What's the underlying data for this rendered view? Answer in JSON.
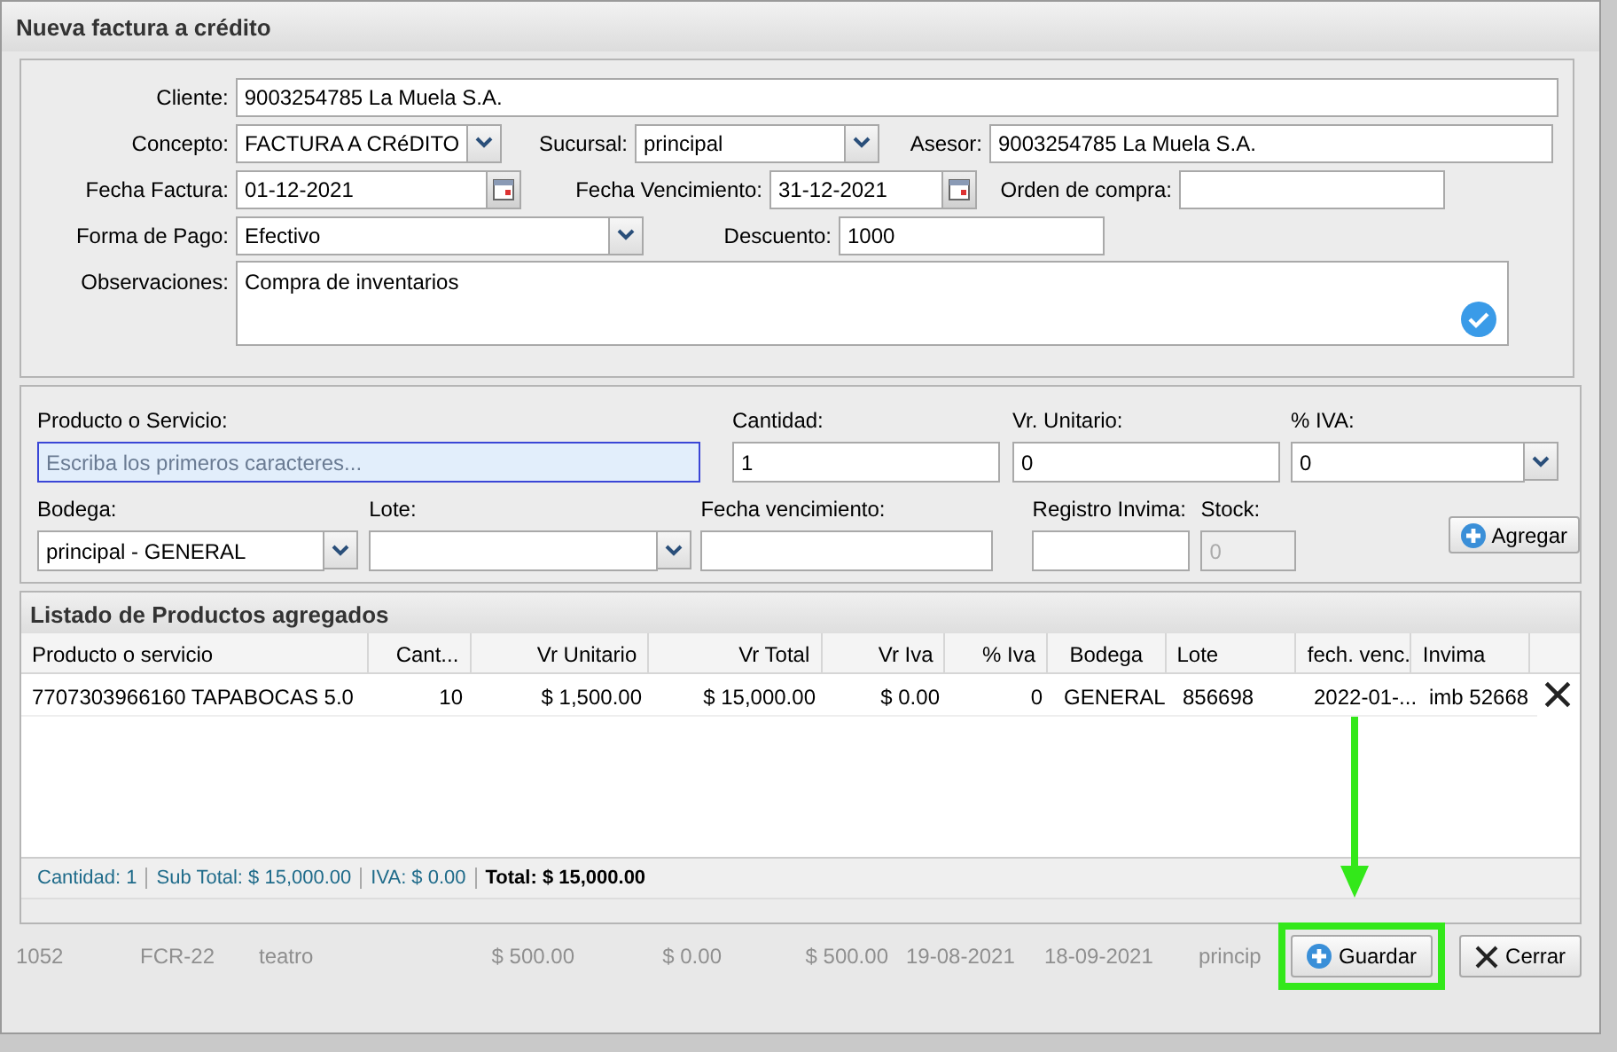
{
  "dialog": {
    "title": "Nueva factura a crédito"
  },
  "header_rows": [
    [
      {
        "label": "Cliente:",
        "kind": "text",
        "value": "9003254785 La Muela S.A."
      }
    ],
    [
      {
        "label": "Concepto:",
        "kind": "select",
        "value": "FACTURA A CRéDITO"
      },
      {
        "label": "Sucursal:",
        "kind": "select",
        "value": "principal"
      },
      {
        "label": "Asesor:",
        "kind": "text",
        "value": "9003254785 La Muela S.A."
      }
    ],
    [
      {
        "label": "Fecha Factura:",
        "kind": "date",
        "value": "01-12-2021"
      },
      {
        "label": "Fecha Vencimiento:",
        "kind": "date",
        "value": "31-12-2021"
      },
      {
        "label": "Orden de compra:",
        "kind": "text"
      }
    ],
    [
      {
        "label": "Forma de Pago:",
        "kind": "select",
        "value": "Efectivo"
      },
      {
        "label": "Descuento:",
        "kind": "text",
        "value": "1000"
      }
    ],
    [
      {
        "label": "Observaciones:",
        "kind": "textarea",
        "value": "Compra de inventarios"
      }
    ]
  ],
  "product_entry": {
    "fields": [
      {
        "label": "Producto o Servicio:",
        "kind": "text",
        "placeholder": "Escriba los primeros caracteres...",
        "focused": true,
        "disabled": false
      },
      {
        "label": "Cantidad:",
        "kind": "text",
        "value": "1",
        "focused": false,
        "disabled": false
      },
      {
        "label": "Vr. Unitario:",
        "kind": "text",
        "value": "0",
        "focused": false,
        "disabled": false
      },
      {
        "label": "% IVA:",
        "kind": "select",
        "value": "0",
        "focused": false,
        "disabled": false
      },
      {
        "label": "Bodega:",
        "kind": "select",
        "value": "principal - GENERAL",
        "focused": false,
        "disabled": false
      },
      {
        "label": "Lote:",
        "kind": "select",
        "focused": false,
        "disabled": false
      },
      {
        "label": "Fecha vencimiento:",
        "kind": "text",
        "focused": false,
        "disabled": false
      },
      {
        "label": "Registro Invima:",
        "kind": "text",
        "focused": false,
        "disabled": false
      },
      {
        "label": "Stock:",
        "kind": "text",
        "value": "0",
        "focused": false,
        "disabled": true
      }
    ],
    "button": "Agregar"
  },
  "products": {
    "title": "Listado de Productos agregados",
    "columns": [
      "Producto o servicio",
      "Cant...",
      "Vr Unitario",
      "Vr Total",
      "Vr Iva",
      "% Iva",
      "Bodega",
      "Lote",
      "fech. venc.",
      "Invima"
    ],
    "rows": [
      {
        "cells": [
          "7707303966160 TAPABOCAS 5.0",
          "10",
          "$ 1,500.00",
          "$ 15,000.00",
          "$ 0.00",
          "0",
          "GENERAL",
          "856698",
          "2022-01-...",
          "imb 52668"
        ]
      }
    ],
    "totals": [
      {
        "text": "Cantidad: 1",
        "emphasis": false
      },
      {
        "text": "Sub Total: $ 15,000.00",
        "emphasis": false
      },
      {
        "text": "IVA: $ 0.00",
        "emphasis": false
      },
      {
        "text": "Total: $ 15,000.00",
        "emphasis": true
      }
    ]
  },
  "background_row": [
    "1052",
    "FCR-22",
    "teatro",
    "$ 500.00",
    "$ 0.00",
    "$ 500.00",
    "19-08-2021",
    "18-09-2021",
    "princip"
  ],
  "footer_buttons": [
    {
      "label": "Guardar",
      "kind": "add",
      "highlighted": true
    },
    {
      "label": "Cerrar",
      "kind": "close",
      "highlighted": false
    }
  ]
}
